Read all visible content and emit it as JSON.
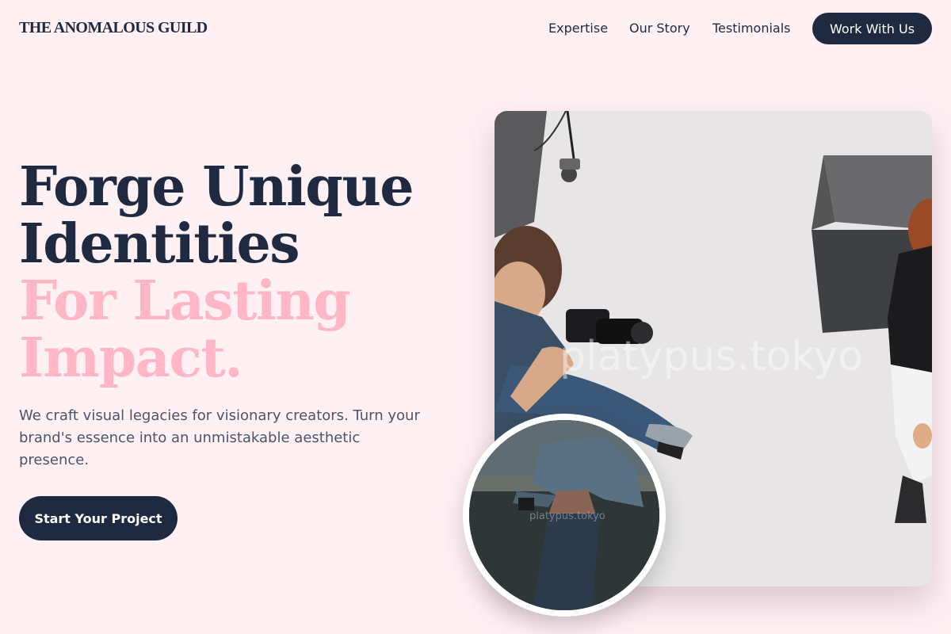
{
  "nav": {
    "logo": "THE ANOMALOUS GUILD",
    "links": [
      "Expertise",
      "Our Story",
      "Testimonials"
    ],
    "cta": "Work With Us"
  },
  "hero": {
    "headline_dark": [
      "Forge Unique",
      "Identities"
    ],
    "headline_pink": [
      "For Lasting",
      "Impact."
    ],
    "subtext": "We craft visual legacies for visionary creators. Turn your brand's essence into an unmistakable aesthetic presence.",
    "cta": "Start Your Project"
  },
  "images": {
    "main_watermark": "platypus.tokyo",
    "circle_watermark": "platypus.tokyo"
  },
  "colors": {
    "background": "#fff0f4",
    "primary": "#1f2a40",
    "accent_pink": "#ffb7c5",
    "body_text": "#4a5568"
  }
}
